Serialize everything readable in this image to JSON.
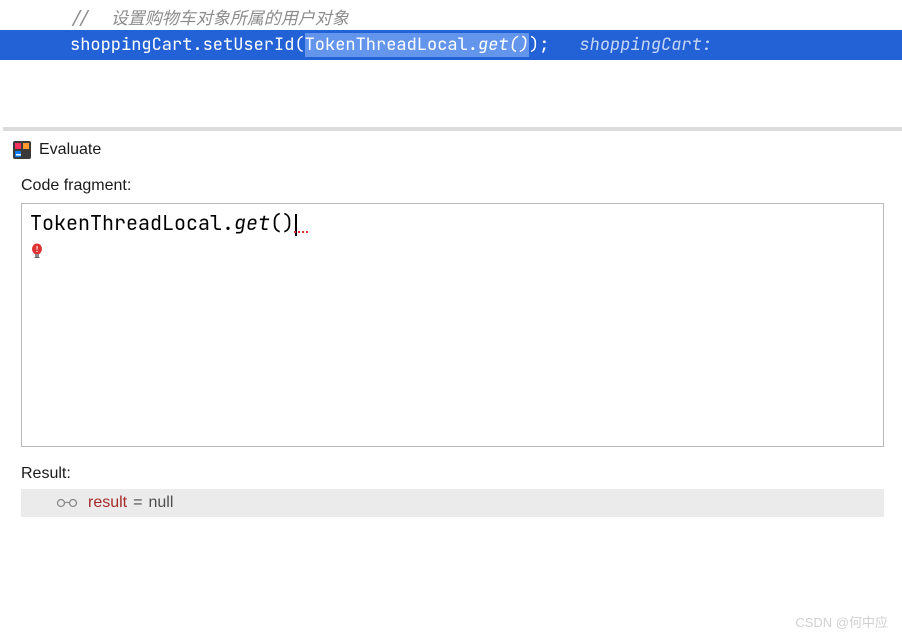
{
  "editor": {
    "comment_prefix": "//  ",
    "comment_text": "设置购物车对象所属的用户对象",
    "line2_part1": "shoppingCart.setUserId(",
    "line2_selected": "TokenThreadLocal.",
    "line2_selected_method": "get()",
    "line2_part2": ");",
    "inline_hint": "shoppingCart:"
  },
  "evaluate": {
    "title": "Evaluate",
    "code_fragment_label": "Code fragment:",
    "fragment_class": "TokenThreadLocal.",
    "fragment_method": "get",
    "fragment_parens": "()",
    "result_label": "Result:",
    "result_name": "result",
    "result_eq": " = ",
    "result_value": "null"
  },
  "watermark": "CSDN @何中应"
}
